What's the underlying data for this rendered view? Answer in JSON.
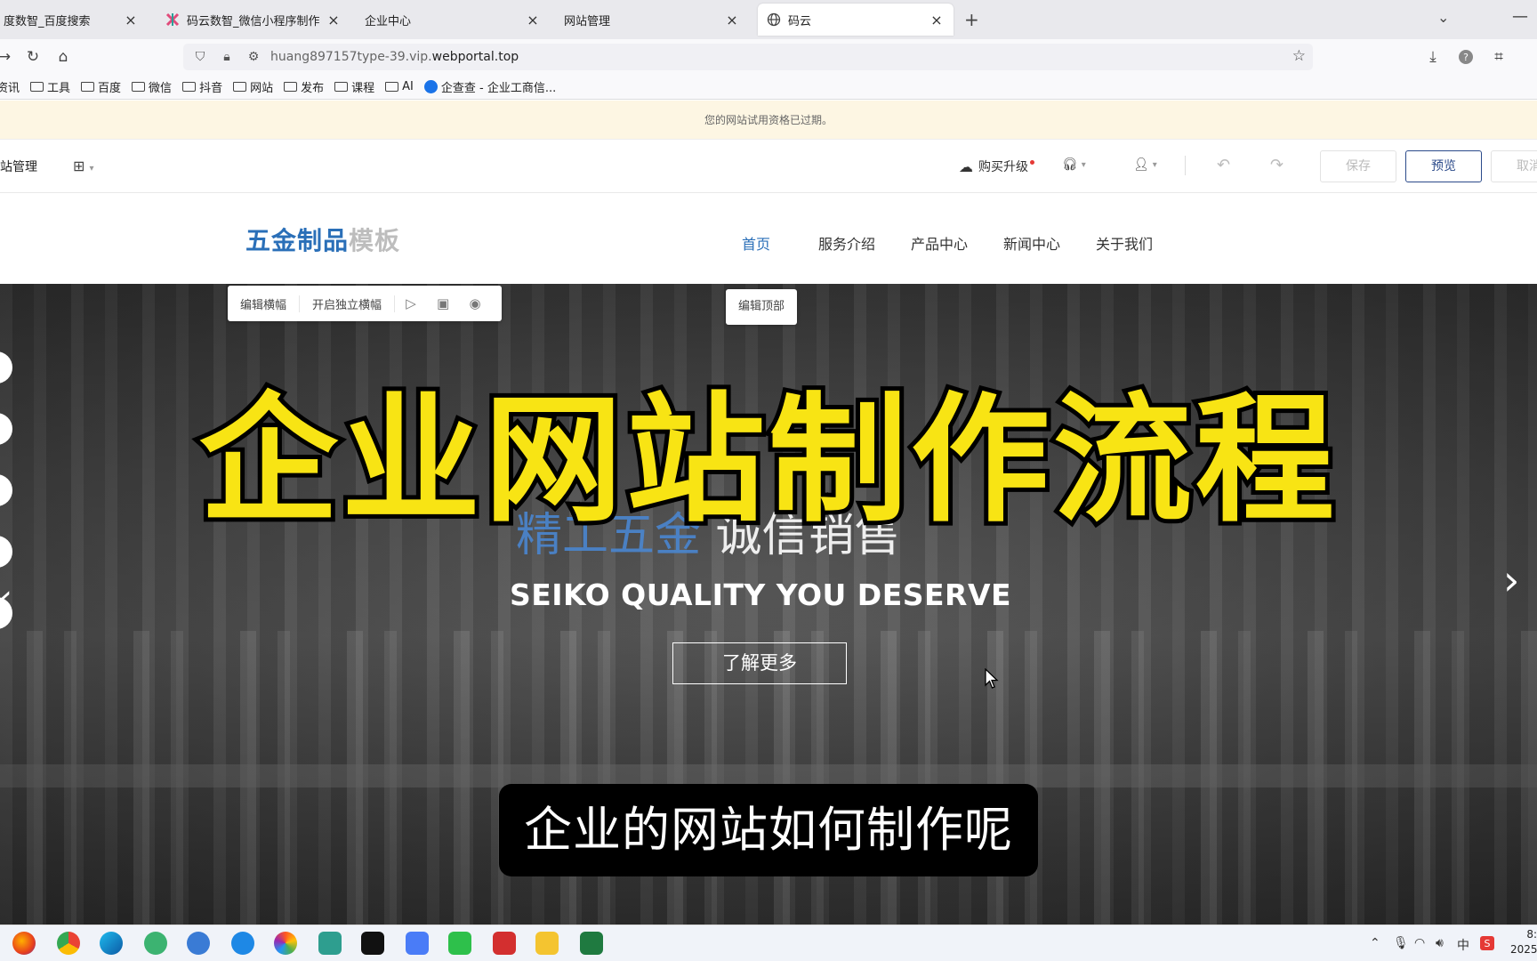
{
  "browser": {
    "tabs": [
      {
        "label": "度数智_百度搜索"
      },
      {
        "label": "码云数智_微信小程序制作平台_"
      },
      {
        "label": "企业中心"
      },
      {
        "label": "网站管理"
      },
      {
        "label": "码云"
      }
    ],
    "url_main": "huang897157type-39.vip.",
    "url_domain": "webportal.top",
    "bookmarks": [
      "资讯",
      "工具",
      "百度",
      "微信",
      "抖音",
      "网站",
      "发布",
      "课程",
      "AI",
      "企查查 - 企业工商信..."
    ]
  },
  "notice": "您的网站试用资格已过期。",
  "editor": {
    "title": "网站管理",
    "upgrade": "购买升级",
    "save": "保存",
    "preview": "预览",
    "cancel": "取消"
  },
  "site": {
    "logo_main": "五金制品",
    "logo_sub": "模板",
    "nav": [
      "首页",
      "服务介绍",
      "产品中心",
      "新闻中心",
      "关于我们"
    ]
  },
  "hero": {
    "tools": [
      "编辑横幅",
      "开启独立横幅"
    ],
    "edit_top": "编辑顶部",
    "headline_blue": "精工五金",
    "headline_white": "   诚信销售",
    "subline": "SEIKO QUALITY YOU DESERVE",
    "button": "了解更多"
  },
  "overlay": {
    "title": "企业网站制作流程",
    "subtitle": "企业的网站如何制作呢"
  },
  "taskbar": {
    "ime": "中",
    "clock_time": "8:",
    "clock_date": "2025"
  },
  "colors": {
    "brand_blue": "#2a6fb8",
    "overlay_yellow": "#f8e414",
    "preview_border": "#2b4a8a"
  }
}
